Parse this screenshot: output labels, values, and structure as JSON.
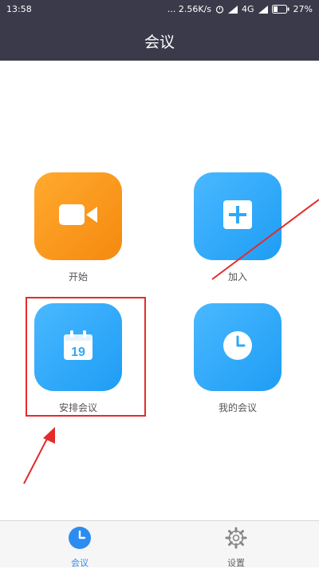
{
  "status_bar": {
    "time": "13:58",
    "network_speed": "... 2.56K/s",
    "network_type": "4G",
    "battery": "27%"
  },
  "header": {
    "title": "会议"
  },
  "tiles": [
    {
      "label": "开始",
      "icon": "video-camera-icon",
      "color": "#f7921e"
    },
    {
      "label": "加入",
      "icon": "plus-icon",
      "color": "#2fa8f8"
    },
    {
      "label": "安排会议",
      "icon": "calendar-icon",
      "calendar_day": "19",
      "color": "#2fa8f8"
    },
    {
      "label": "我的会议",
      "icon": "clock-icon",
      "color": "#2fa8f8"
    }
  ],
  "bottom_nav": {
    "items": [
      {
        "label": "会议",
        "icon": "meeting-clock-icon",
        "active": true
      },
      {
        "label": "设置",
        "icon": "gear-icon",
        "active": false
      }
    ]
  },
  "colors": {
    "header_bg": "#3a3a4a",
    "accent": "#2d8cf0",
    "annotation": "#e52a2a"
  }
}
